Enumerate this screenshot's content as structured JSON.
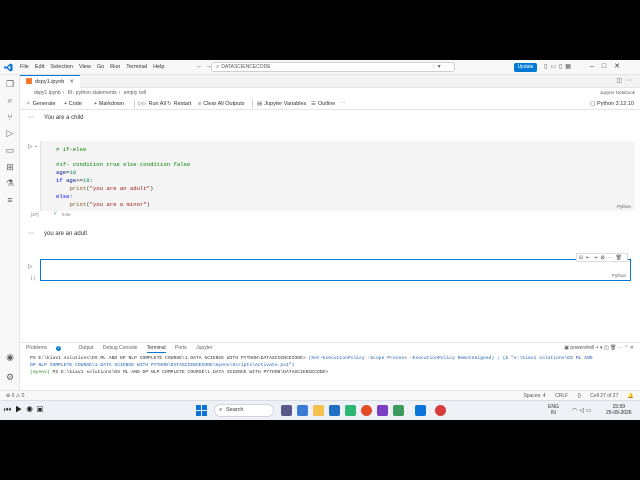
{
  "titlebar": {
    "menu": [
      "File",
      "Edit",
      "Selection",
      "View",
      "Go",
      "Run",
      "Terminal",
      "Help"
    ],
    "search_value": "DATASCIENCECODE",
    "update_label": "Update"
  },
  "tab": {
    "label": "dspy1.ipynb"
  },
  "breadcrumb": {
    "parts": [
      "dspy1.ipynb",
      "M↓ python statements",
      "empty cell"
    ],
    "right_label": "Jupyter Notebook"
  },
  "toolbar": {
    "generate": "Generate",
    "code": "+ Code",
    "markdown": "+ Markdown",
    "run_all": "Run All",
    "restart": "Restart",
    "clear_outputs": "Clear All Outputs",
    "variables": "Jupyter Variables",
    "outline": "Outline",
    "kernel": "Python 3.12.10"
  },
  "cells": {
    "prev_output": "You are a child",
    "code_lines": {
      "comment1": "# if-else",
      "comment2": "#if- condition true else condition false",
      "line_age_var": "age",
      "line_age_rest": "=",
      "line_age_num": "18",
      "line_if_kw": "if",
      "line_if_var": "age",
      "line_if_op": ">=",
      "line_if_num": "18",
      "line_if_end": ":",
      "print1_fn": "print",
      "print1_str": "\"you are an adult\"",
      "else_kw": "else",
      "else_end": ":",
      "print2_fn": "print",
      "print2_str": "\"you are a minor\""
    },
    "lang": "Python",
    "exec_count": "[47]",
    "exec_time": "0.0s",
    "output": "you are an adult",
    "empty_lang": "Python",
    "empty_exec": "[ ]"
  },
  "panel": {
    "tabs": [
      "Problems",
      "Output",
      "Debug Console",
      "Terminal",
      "Ports",
      "Jupyter"
    ],
    "problems_count": "2",
    "shell": "powershell",
    "terminal": {
      "line1_prompt": "PS E:\\kiav1 solutions\\DS ML AND DP NLP COMPLETE COURSE\\1.DATA SCIENCE WITH PYTHON\\DATASCIENCECODE>",
      "line1_cmd": " (Set-ExecutionPolicy -Scope Process -ExecutionPolicy RemoteSigned) ; (& \"e:\\kiav1 solutions\\DS ML AND",
      "line2": "DP NLP COMPLETE COURSE\\1.DATA SCIENCE WITH PYTHON\\DATASCIENCECODE\\myenv\\Scripts\\Activate.ps1\")",
      "line3_env": "(myenv)",
      "line3_rest": " PS E:\\kiav1 solutions\\DS ML AND DP NLP COMPLETE COURSE\\1.DATA SCIENCE WITH PYTHON\\DATASCIENCECODE>"
    }
  },
  "statusbar": {
    "left": "⊗ 0 ⚠ 0",
    "spaces": "Spaces: 4",
    "eol": "CRLF",
    "cell": "Cell 27 of 27"
  },
  "taskbar": {
    "search": "Search",
    "lang": "ENG",
    "region": "IN",
    "time": "15:59",
    "date": "25-09-2026"
  },
  "colors": {
    "accent": "#0078d4",
    "comment": "#008000",
    "string": "#a31515",
    "keyword": "#0000ff"
  }
}
